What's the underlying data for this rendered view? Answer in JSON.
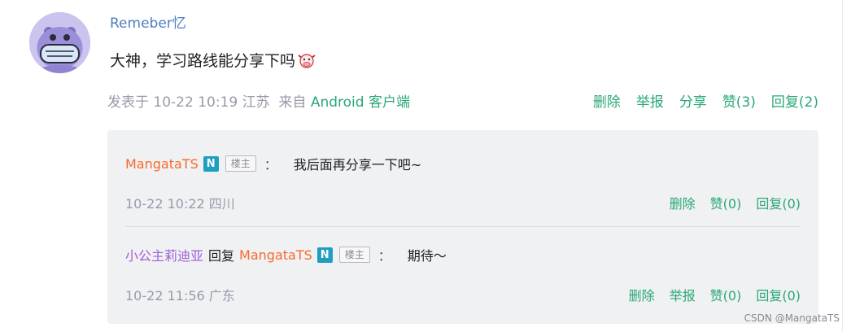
{
  "comment": {
    "author": "Remeber忆",
    "text": "大神，学习路线能分享下吗",
    "emoji_icon": "ox-face-emoji",
    "meta_prefix": "发表于 10-22 10:19 江苏",
    "meta_from": "来自",
    "meta_client": "Android 客户端",
    "actions": [
      "删除",
      "举报",
      "分享",
      "赞(3)",
      "回复(2)"
    ]
  },
  "replies": [
    {
      "user": "MangataTS",
      "badge": "N",
      "owner_tag": "楼主",
      "colon": "：",
      "text": "我后面再分享一下吧~",
      "time": "10-22 10:22 四川",
      "actions": [
        "删除",
        "赞(0)",
        "回复(0)"
      ]
    },
    {
      "user": "小公主莉迪亚",
      "reply_word": "回复",
      "target": "MangataTS",
      "badge": "N",
      "owner_tag": "楼主",
      "colon": "：",
      "text": "期待～",
      "time": "10-22 11:56 广东",
      "actions": [
        "删除",
        "举报",
        "赞(0)",
        "回复(0)"
      ]
    }
  ],
  "watermark": "CSDN @MangataTS",
  "colors": {
    "accent_green": "#2aa876",
    "orange_user": "#f86b2d",
    "purple_user": "#a05fd6",
    "badge_blue": "#1e9fbf",
    "reply_bg": "#f0f1f3"
  }
}
